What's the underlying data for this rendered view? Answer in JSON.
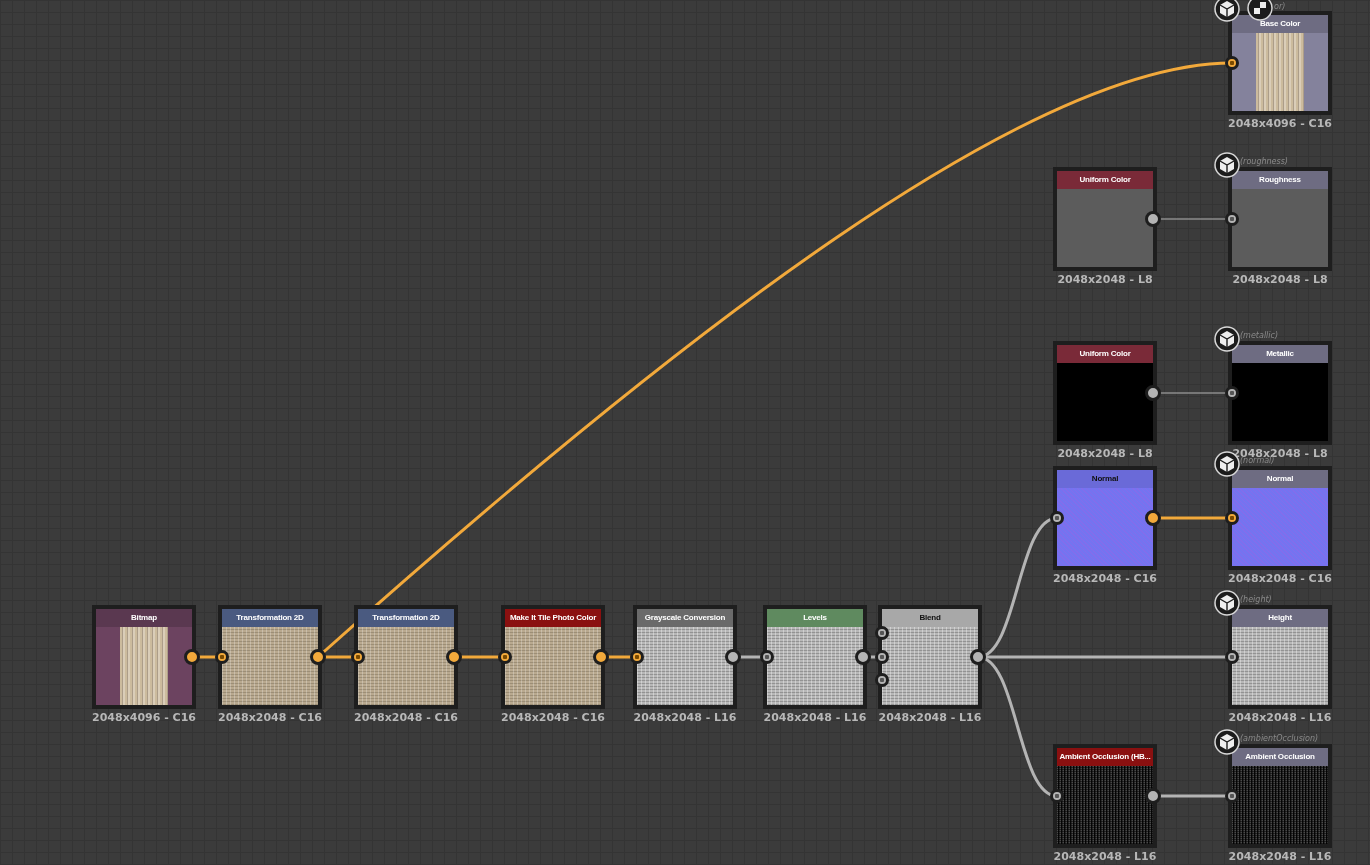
{
  "nodes": [
    {
      "kind": "output",
      "title": "Base Color",
      "color": "#6e6c82",
      "preview": {
        "kind": "narrow_photo"
      },
      "resolution": "2048x4096 - C16",
      "tag": "or)",
      "viewed": true
    },
    {
      "kind": "generator",
      "title": "Uniform Color",
      "color": "#7a2a38",
      "preview": {
        "kind": "flat_gray"
      },
      "resolution": "2048x2048 - L8",
      "output_active": false
    },
    {
      "kind": "output",
      "title": "Roughness",
      "color": "#6e6c82",
      "preview": {
        "kind": "flat_gray"
      },
      "resolution": "2048x2048 - L8",
      "tag": "(roughness)",
      "viewed": false
    },
    {
      "kind": "generator",
      "title": "Uniform Color",
      "color": "#7a2a38",
      "preview": {
        "kind": "flat_black"
      },
      "resolution": "2048x2048 - L8",
      "output_active": false
    },
    {
      "kind": "output",
      "title": "Metallic",
      "color": "#6e6c82",
      "preview": {
        "kind": "flat_black"
      },
      "resolution": "2048x2048 - L8",
      "tag": "(metallic)",
      "viewed": false
    },
    {
      "kind": "filter",
      "title": "Normal",
      "color": "#6a6ad8",
      "preview": {
        "kind": "normal"
      },
      "resolution": "2048x2048 - C16",
      "output_active": true
    },
    {
      "kind": "output",
      "title": "Normal",
      "color": "#6e6c82",
      "preview": {
        "kind": "normal"
      },
      "resolution": "2048x2048 - C16",
      "tag": "(normal)",
      "viewed": false
    },
    {
      "kind": "bitmap",
      "title": "Bitmap",
      "color": "#5a3850",
      "preview": {
        "kind": "narrow_photo"
      },
      "resolution": "2048x4096 - C16",
      "output_active": true
    },
    {
      "kind": "filter",
      "title": "Transformation 2D",
      "color": "#4a5a80",
      "preview": {
        "kind": "photo"
      },
      "resolution": "2048x2048 - C16",
      "output_active": true
    },
    {
      "kind": "filter",
      "title": "Transformation 2D",
      "color": "#4a5a80",
      "preview": {
        "kind": "photo"
      },
      "resolution": "2048x2048 - C16",
      "output_active": true
    },
    {
      "kind": "filter",
      "title": "Make It Tile Photo Color",
      "color": "#8a1010",
      "preview": {
        "kind": "photo"
      },
      "resolution": "2048x2048 - C16",
      "output_active": true
    },
    {
      "kind": "filter",
      "title": "Grayscale Conversion",
      "color": "#6a6a6a",
      "preview": {
        "kind": "grayscale"
      },
      "resolution": "2048x2048 - L16",
      "output_active": false
    },
    {
      "kind": "filter",
      "title": "Levels",
      "color": "#5f8a5f",
      "preview": {
        "kind": "grayscale"
      },
      "resolution": "2048x2048 - L16",
      "output_active": false
    },
    {
      "kind": "blend",
      "title": "Blend",
      "color": "#a8a8a8",
      "preview": {
        "kind": "grayscale"
      },
      "resolution": "2048x2048 - L16",
      "output_active": false
    },
    {
      "kind": "output",
      "title": "Height",
      "color": "#6e6c82",
      "preview": {
        "kind": "grayscale"
      },
      "resolution": "2048x2048 - L16",
      "tag": "(height)",
      "viewed": false
    },
    {
      "kind": "filter",
      "title": "Ambient Occlusion (HB...",
      "color": "#8a1010",
      "preview": {
        "kind": "noise"
      },
      "resolution": "2048x2048 - L16",
      "output_active": false
    },
    {
      "kind": "output",
      "title": "Ambient Occlusion",
      "color": "#6e6c82",
      "preview": {
        "kind": "noise"
      },
      "resolution": "2048x2048 - L16",
      "tag": "(ambientOcclusion)",
      "viewed": false
    }
  ]
}
